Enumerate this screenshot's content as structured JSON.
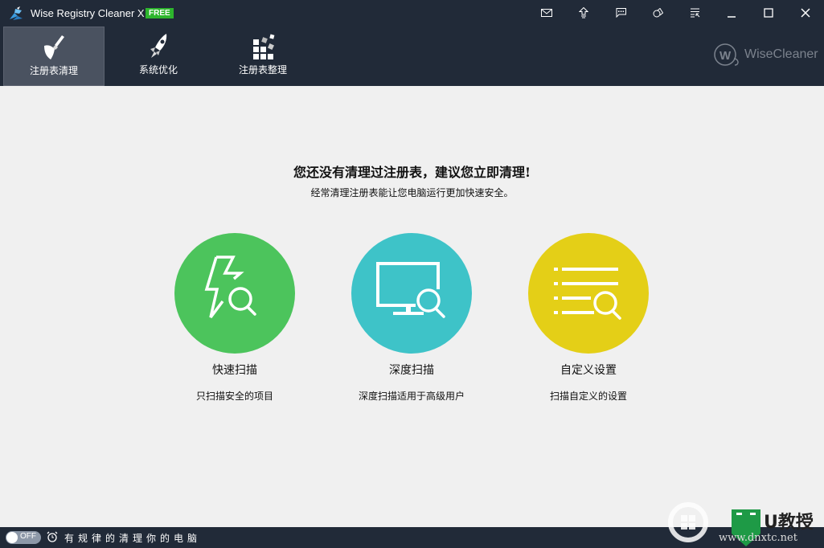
{
  "window": {
    "title": "Wise Registry Cleaner X",
    "badge": "FREE",
    "controls": [
      {
        "name": "mail-icon"
      },
      {
        "name": "upgrade-icon"
      },
      {
        "name": "feedback-icon"
      },
      {
        "name": "skin-icon"
      },
      {
        "name": "menu-icon"
      },
      {
        "name": "minimize-icon"
      },
      {
        "name": "maximize-icon"
      },
      {
        "name": "close-icon"
      }
    ]
  },
  "tabs": [
    {
      "label": "注册表清理",
      "icon": "broom-icon",
      "active": true
    },
    {
      "label": "系统优化",
      "icon": "rocket-icon",
      "active": false
    },
    {
      "label": "注册表整理",
      "icon": "defrag-blocks-icon",
      "active": false
    }
  ],
  "brand": {
    "text": "WiseCleaner",
    "logo": "W"
  },
  "main": {
    "headline": "您还没有清理过注册表，建议您立即清理!",
    "subline": "经常清理注册表能让您电脑运行更加快速安全。",
    "cards": [
      {
        "title": "快速扫描",
        "desc": "只扫描安全的项目",
        "color": "#4cc45c",
        "icon": "lightning-search-icon"
      },
      {
        "title": "深度扫描",
        "desc": "深度扫描适用于高级用户",
        "color": "#3ec3c8",
        "icon": "monitor-search-icon"
      },
      {
        "title": "自定义设置",
        "desc": "扫描自定义的设置",
        "color": "#e4cf17",
        "icon": "list-search-icon"
      }
    ]
  },
  "footer": {
    "toggle_label": "OFF",
    "schedule_text": "有规律的清理你的电脑"
  },
  "watermark": {
    "text": "U教授",
    "url": "www.dnxtc.net"
  }
}
